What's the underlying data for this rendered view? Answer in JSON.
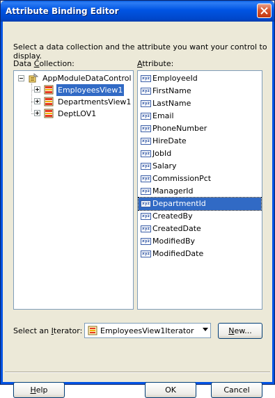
{
  "window": {
    "title": "Attribute Binding Editor"
  },
  "instruction": "Select a data collection and the attribute you want your control to display.",
  "data_collection": {
    "label_prefix": "Data ",
    "label_mnemonic": "C",
    "label_suffix": "ollection:",
    "root": "AppModuleDataControl",
    "children": [
      "EmployeesView1",
      "DepartmentsView1",
      "DeptLOV1"
    ],
    "selected": "EmployeesView1"
  },
  "attribute": {
    "label_mnemonic": "A",
    "label_suffix": "ttribute:",
    "icon_text": "xyz",
    "items": [
      "EmployeeId",
      "FirstName",
      "LastName",
      "Email",
      "PhoneNumber",
      "HireDate",
      "JobId",
      "Salary",
      "CommissionPct",
      "ManagerId",
      "DepartmentId",
      "CreatedBy",
      "CreatedDate",
      "ModifiedBy",
      "ModifiedDate"
    ],
    "selected": "DepartmentId"
  },
  "iterator": {
    "label_prefix": "Select an ",
    "label_mnemonic": "I",
    "label_suffix": "terator:",
    "value": "EmployeesView1Iterator"
  },
  "buttons": {
    "new_mnemonic": "N",
    "new_suffix": "ew...",
    "help_mnemonic": "H",
    "help_suffix": "elp",
    "ok": "OK",
    "cancel": "Cancel"
  }
}
